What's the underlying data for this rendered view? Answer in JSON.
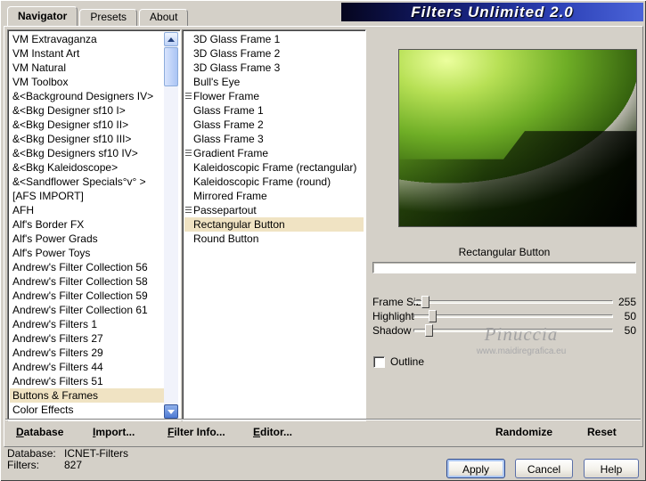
{
  "window": {
    "title": "Filters Unlimited 2.0"
  },
  "tabs": [
    {
      "label": "Navigator",
      "active": true
    },
    {
      "label": "Presets",
      "active": false
    },
    {
      "label": "About",
      "active": false
    }
  ],
  "categories": {
    "selected": "Buttons & Frames",
    "items": [
      "VM Extravaganza",
      "VM Instant Art",
      "VM Natural",
      "VM Toolbox",
      "&<Background Designers IV>",
      "&<Bkg Designer sf10 I>",
      "&<Bkg Designer sf10 II>",
      "&<Bkg Designer sf10 III>",
      "&<Bkg Designers sf10 IV>",
      "&<Bkg Kaleidoscope>",
      "&<Sandflower Specials°v° >",
      "[AFS IMPORT]",
      "AFH",
      "Alf's Border FX",
      "Alf's Power Grads",
      "Alf's Power Toys",
      "Andrew's Filter Collection 56",
      "Andrew's Filter Collection 58",
      "Andrew's Filter Collection 59",
      "Andrew's Filter Collection 61",
      "Andrew's Filters 1",
      "Andrew's Filters 27",
      "Andrew's Filters 29",
      "Andrew's Filters 44",
      "Andrew's Filters 51",
      "Buttons & Frames",
      "Color Effects"
    ]
  },
  "filters": {
    "selected": "Rectangular Button",
    "items": [
      {
        "label": "3D Glass Frame 1",
        "marker": false
      },
      {
        "label": "3D Glass Frame 2",
        "marker": false
      },
      {
        "label": "3D Glass Frame 3",
        "marker": false
      },
      {
        "label": "Bull's Eye",
        "marker": false
      },
      {
        "label": "Flower Frame",
        "marker": true
      },
      {
        "label": "Glass Frame 1",
        "marker": false
      },
      {
        "label": "Glass Frame 2",
        "marker": false
      },
      {
        "label": "Glass Frame 3",
        "marker": false
      },
      {
        "label": "Gradient Frame",
        "marker": true
      },
      {
        "label": "Kaleidoscopic Frame (rectangular)",
        "marker": false
      },
      {
        "label": "Kaleidoscopic Frame (round)",
        "marker": false
      },
      {
        "label": "Mirrored Frame",
        "marker": false
      },
      {
        "label": "Passepartout",
        "marker": true
      },
      {
        "label": "Rectangular Button",
        "marker": false
      },
      {
        "label": "Round Button",
        "marker": false
      }
    ]
  },
  "preview": {
    "selected_filter": "Rectangular Button"
  },
  "controls": {
    "sliders": [
      {
        "label": "Frame Size",
        "value": "255",
        "thumb_pct": 4
      },
      {
        "label": "Highlight",
        "value": "50",
        "thumb_pct": 8
      },
      {
        "label": "Shadow",
        "value": "50",
        "thumb_pct": 6
      }
    ],
    "outline": {
      "label": "Outline",
      "checked": false
    }
  },
  "watermark": {
    "name": "Pinuccia",
    "url": "www.maidiregrafica.eu"
  },
  "toolbar": {
    "buttons_left": [
      {
        "label": "Database"
      },
      {
        "label": "Import..."
      },
      {
        "label": "Filter Info..."
      },
      {
        "label": "Editor..."
      }
    ],
    "buttons_right": [
      {
        "label": "Randomize"
      },
      {
        "label": "Reset"
      }
    ]
  },
  "status": {
    "rows": [
      {
        "label": "Database:",
        "value": "ICNET-Filters"
      },
      {
        "label": "Filters:",
        "value": "827"
      }
    ]
  },
  "footer": {
    "apply": "Apply",
    "cancel": "Cancel",
    "help": "Help"
  },
  "colors": {
    "dialog_bg": "#d4d0c8",
    "selection_bg": "#f0e3c3",
    "banner_blue": "#2b3fb4",
    "preview_green": "#6fae26"
  }
}
